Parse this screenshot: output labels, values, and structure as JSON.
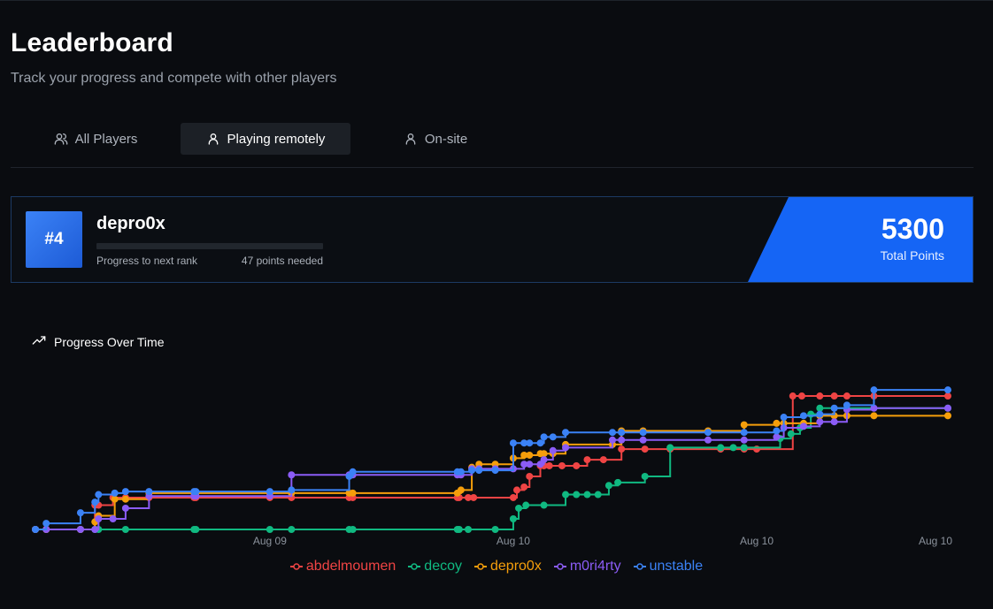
{
  "header": {
    "title": "Leaderboard",
    "subtitle": "Track your progress and compete with other players"
  },
  "tabs": [
    {
      "label": "All Players",
      "icon": "users-icon",
      "active": false
    },
    {
      "label": "Playing remotely",
      "icon": "user-icon",
      "active": true
    },
    {
      "label": "On-site",
      "icon": "user-icon",
      "active": false
    }
  ],
  "player": {
    "rank": "#4",
    "name": "depro0x",
    "progress_label": "Progress to next rank",
    "points_needed": "47 points needed",
    "progress_fraction": 0.0,
    "total_points": "5300",
    "total_label": "Total Points"
  },
  "colors": {
    "accent": "#1565f5",
    "abdelmoumen": "#ef4444",
    "decoy": "#10b981",
    "depro0x": "#f59e0b",
    "m0ri4rty": "#8b5cf6",
    "unstable": "#3b82f6"
  },
  "chart": {
    "title": "Progress Over Time",
    "icon": "trending-up-icon"
  },
  "chart_data": {
    "type": "line",
    "step": true,
    "title": "Progress Over Time",
    "xlabel": "",
    "ylabel": "",
    "x_ticks": [
      "Aug 09",
      "Aug 10",
      "Aug 10",
      "Aug 10"
    ],
    "x_tick_hours": [
      13,
      26.5,
      40,
      50.6
    ],
    "xlim_hours": [
      0,
      50.6
    ],
    "ylim": [
      0,
      5800
    ],
    "x_unit": "hours since first solve (tick labels show dates)",
    "grid": false,
    "legend": "bottom",
    "series": [
      {
        "name": "abdelmoumen",
        "color": "#ef4444",
        "x": [
          0,
          0.6,
          2.5,
          3.3,
          3.5,
          4.3,
          5,
          6.3,
          8.8,
          8.9,
          13,
          14.2,
          17.4,
          17.6,
          23.4,
          23.5,
          24,
          24.3,
          26.5,
          26.7,
          27.1,
          27.4,
          28,
          28.2,
          28.5,
          29.2,
          30,
          30.6,
          31.5,
          32.5,
          33.8,
          35.2,
          38,
          39.3,
          40,
          42,
          42.5,
          43.5,
          44.3,
          45,
          46.5,
          50.6
        ],
        "y": [
          0,
          0,
          0,
          800,
          800,
          1050,
          1050,
          1050,
          1050,
          1050,
          1050,
          1050,
          1050,
          1050,
          1050,
          1050,
          1050,
          1050,
          1050,
          1300,
          1400,
          1750,
          2100,
          2100,
          2100,
          2100,
          2100,
          2300,
          2300,
          2650,
          2650,
          2650,
          2650,
          2650,
          2650,
          4400,
          4400,
          4400,
          4400,
          4400,
          4400,
          4400
        ]
      },
      {
        "name": "decoy",
        "color": "#10b981",
        "x": [
          0,
          0.6,
          2.5,
          3.3,
          3.5,
          5,
          8.8,
          8.9,
          13,
          14.2,
          17.4,
          17.6,
          23.4,
          23.5,
          24,
          25.5,
          26.5,
          26.8,
          27.2,
          28.2,
          29.4,
          30,
          30.6,
          31.2,
          31.8,
          32.3,
          33.8,
          35.2,
          38,
          38.7,
          39.3,
          41.3,
          41.9,
          42.4,
          43,
          43.5,
          50.6
        ],
        "y": [
          0,
          0,
          0,
          0,
          0,
          0,
          0,
          0,
          0,
          0,
          0,
          0,
          0,
          0,
          0,
          0,
          350,
          700,
          800,
          800,
          1150,
          1150,
          1150,
          1150,
          1450,
          1550,
          1750,
          2700,
          2700,
          2700,
          2700,
          3000,
          3150,
          3350,
          3800,
          4000,
          4000
        ]
      },
      {
        "name": "depro0x",
        "color": "#f59e0b",
        "x": [
          0,
          0.6,
          2.5,
          3.3,
          3.5,
          4.4,
          5,
          6.3,
          8.8,
          8.9,
          13,
          14.2,
          17.4,
          17.6,
          23.4,
          23.6,
          24.2,
          24.6,
          25.5,
          26.5,
          27.1,
          27.4,
          28,
          28.2,
          28.7,
          29.4,
          32,
          32.5,
          33.7,
          37.3,
          39.3,
          41.1,
          41.5,
          42.6,
          43.5,
          44.3,
          45,
          46.5,
          50.6
        ],
        "y": [
          0,
          0,
          0,
          250,
          450,
          1000,
          1000,
          1200,
          1200,
          1200,
          1200,
          1200,
          1200,
          1200,
          1200,
          1300,
          2050,
          2150,
          2150,
          2350,
          2450,
          2450,
          2500,
          2500,
          2500,
          2800,
          2800,
          3250,
          3250,
          3250,
          3450,
          3500,
          3500,
          3500,
          3750,
          3750,
          3750,
          3750,
          3750
        ]
      },
      {
        "name": "m0ri4rty",
        "color": "#8b5cf6",
        "x": [
          0,
          0.6,
          2.5,
          3.3,
          3.5,
          4.3,
          5,
          6.3,
          8.8,
          8.9,
          13,
          14.2,
          17.4,
          17.6,
          23.4,
          23.6,
          24.2,
          24.6,
          25.5,
          26.5,
          27.1,
          27.4,
          28,
          28.2,
          28.7,
          29.4,
          32,
          32.5,
          33.7,
          37.3,
          39.3,
          41.1,
          41.5,
          42.6,
          43.5,
          44.3,
          45,
          46.5,
          50.6
        ],
        "y": [
          0,
          0,
          0,
          0,
          350,
          350,
          700,
          1100,
          1100,
          1100,
          1100,
          1800,
          1800,
          1800,
          1800,
          1800,
          2000,
          2000,
          2000,
          2000,
          2150,
          2150,
          2150,
          2300,
          2600,
          2700,
          2950,
          2950,
          2950,
          2950,
          2950,
          3050,
          3350,
          3400,
          3550,
          3550,
          3950,
          4000,
          4000
        ]
      },
      {
        "name": "unstable",
        "color": "#3b82f6",
        "x": [
          0,
          0.6,
          2.5,
          3.3,
          3.5,
          4.4,
          5,
          6.3,
          8.8,
          8.9,
          13,
          14.2,
          17.4,
          17.6,
          23.4,
          23.6,
          24.2,
          24.6,
          25.5,
          26.5,
          27.1,
          27.4,
          28,
          28.2,
          28.7,
          29.4,
          32,
          32.5,
          33.7,
          37.3,
          39.3,
          41.1,
          41.5,
          42.6,
          43.5,
          44.3,
          45,
          46.5,
          50.6
        ],
        "y": [
          0,
          200,
          550,
          900,
          1150,
          1200,
          1250,
          1250,
          1250,
          1250,
          1250,
          1300,
          1750,
          1900,
          1900,
          1900,
          1950,
          1950,
          1950,
          2850,
          2850,
          2850,
          2850,
          3050,
          3050,
          3200,
          3200,
          3200,
          3200,
          3200,
          3200,
          3250,
          3700,
          3750,
          3800,
          4000,
          4100,
          4600,
          4600
        ]
      }
    ]
  }
}
